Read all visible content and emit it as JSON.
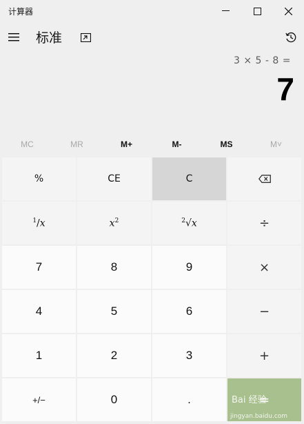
{
  "window": {
    "title": "计算器",
    "minimize_glyph": "—",
    "maximize_glyph": "☐",
    "close_glyph": "✕"
  },
  "header": {
    "mode": "标准",
    "menu_icon": "hamburger-icon",
    "overlay_icon": "keep-on-top-icon",
    "history_icon": "history-icon"
  },
  "display": {
    "expression": "3 × 5 - 8 =",
    "result": "7"
  },
  "memory": [
    {
      "label": "MC",
      "enabled": false
    },
    {
      "label": "MR",
      "enabled": false
    },
    {
      "label": "M+",
      "enabled": true
    },
    {
      "label": "M-",
      "enabled": true
    },
    {
      "label": "MS",
      "enabled": true
    },
    {
      "label": "M˅",
      "enabled": false
    }
  ],
  "keys": {
    "percent": "%",
    "ce": "CE",
    "c": "C",
    "backspace": "⌫",
    "reciprocal_num": "1",
    "reciprocal_den": "x",
    "square_base": "x",
    "square_exp": "2",
    "sqrt_index": "2",
    "sqrt_sym": "√x",
    "divide": "÷",
    "seven": "7",
    "eight": "8",
    "nine": "9",
    "multiply": "×",
    "four": "4",
    "five": "5",
    "six": "6",
    "minus": "−",
    "one": "1",
    "two": "2",
    "three": "3",
    "plus": "+",
    "negate": "+/−",
    "zero": "0",
    "decimal": ".",
    "equals": "="
  },
  "watermark": {
    "text": "Bai 经验",
    "sub": "jingyan.baidu.com"
  },
  "colors": {
    "background": "#efefef",
    "key": "#f4f4f4",
    "digit_key": "#fbfbfb",
    "pressed_key": "#d6d6d6",
    "equals_key": "#a8bf8e"
  }
}
